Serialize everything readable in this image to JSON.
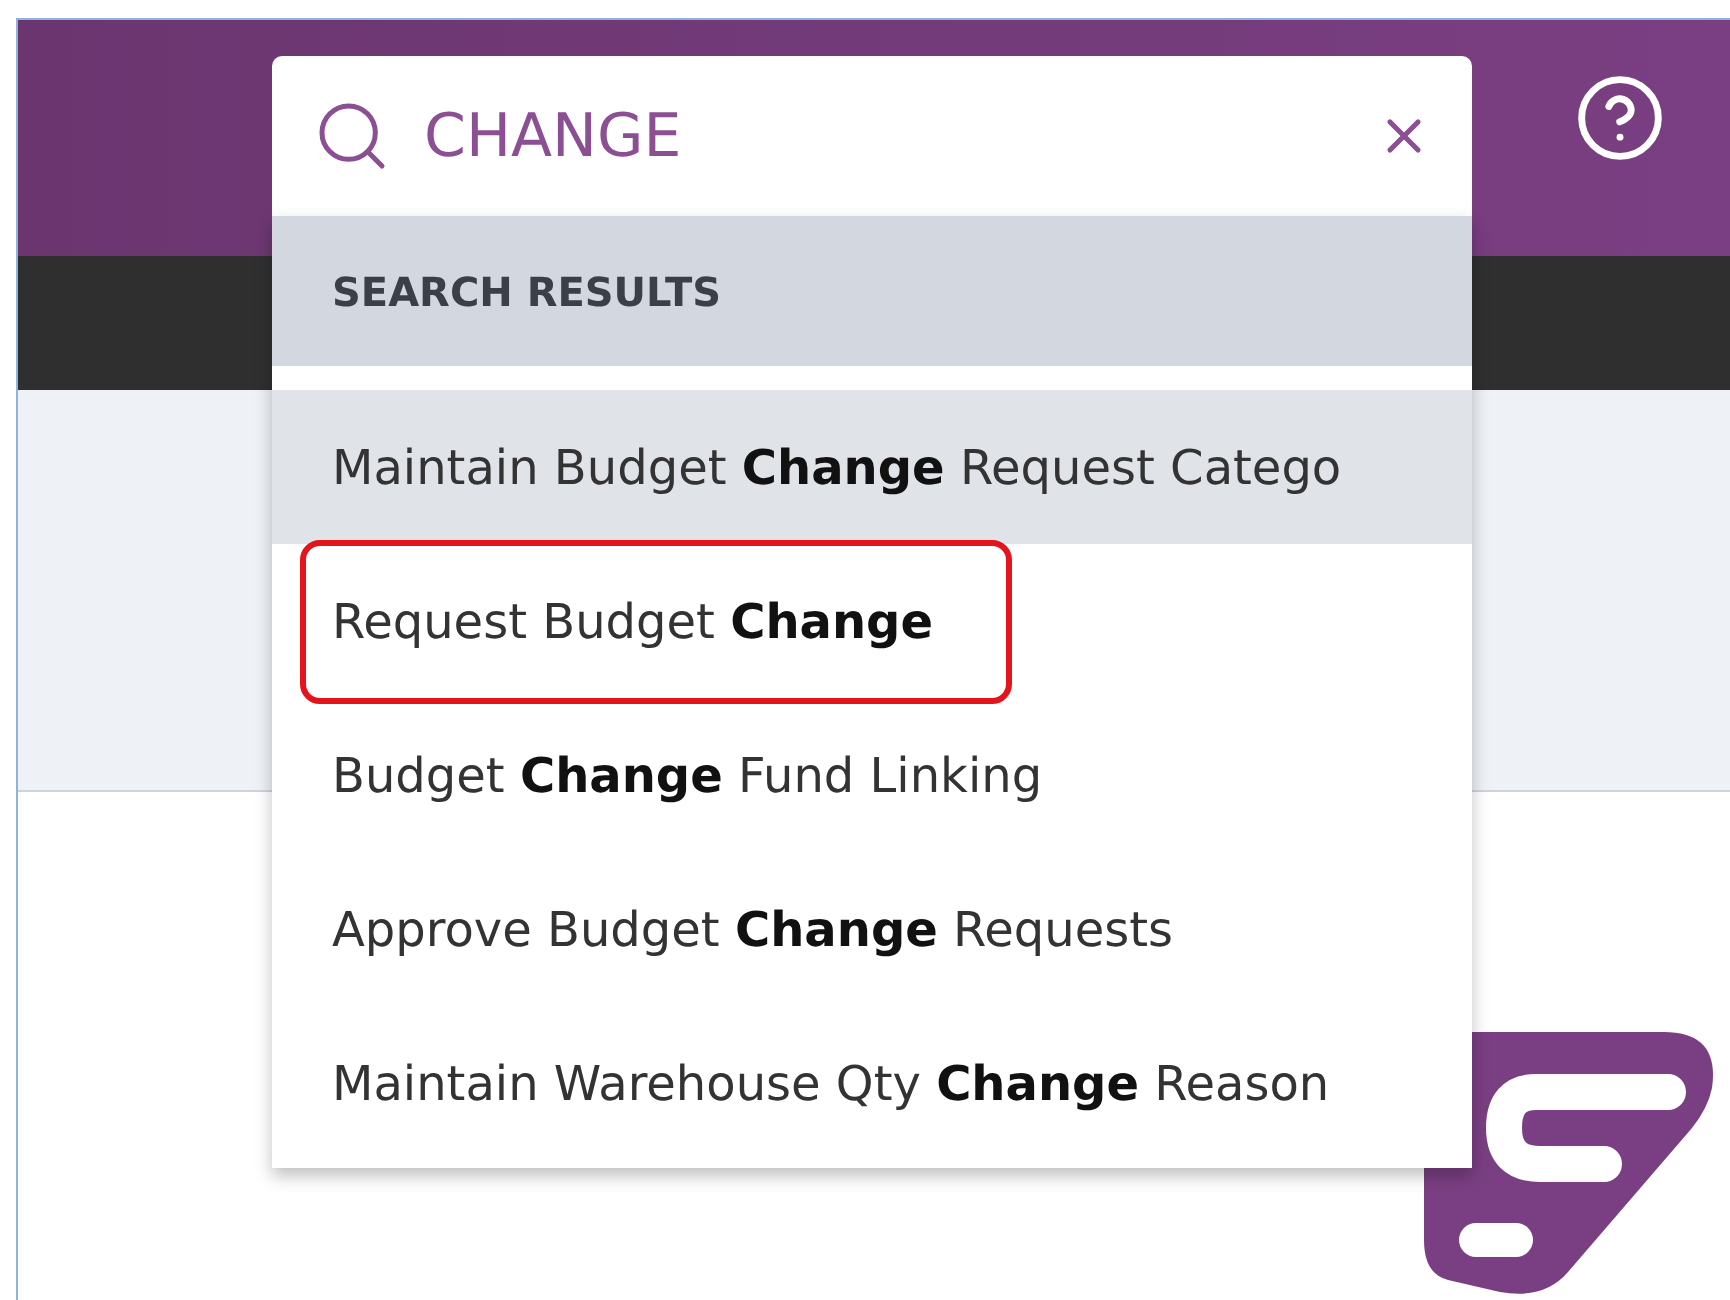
{
  "search": {
    "value": "CHANGE"
  },
  "results": {
    "header": "SEARCH RESULTS",
    "items": [
      {
        "label": "Maintain Budget **Change** Request Catego",
        "selected": true,
        "outlined": false
      },
      {
        "label": "Request Budget **Change**",
        "selected": false,
        "outlined": true
      },
      {
        "label": "Budget **Change** Fund Linking",
        "selected": false,
        "outlined": false
      },
      {
        "label": "Approve Budget **Change** Requests",
        "selected": false,
        "outlined": false
      },
      {
        "label": "Maintain Warehouse Qty **Change** Reason",
        "selected": false,
        "outlined": false
      }
    ]
  }
}
